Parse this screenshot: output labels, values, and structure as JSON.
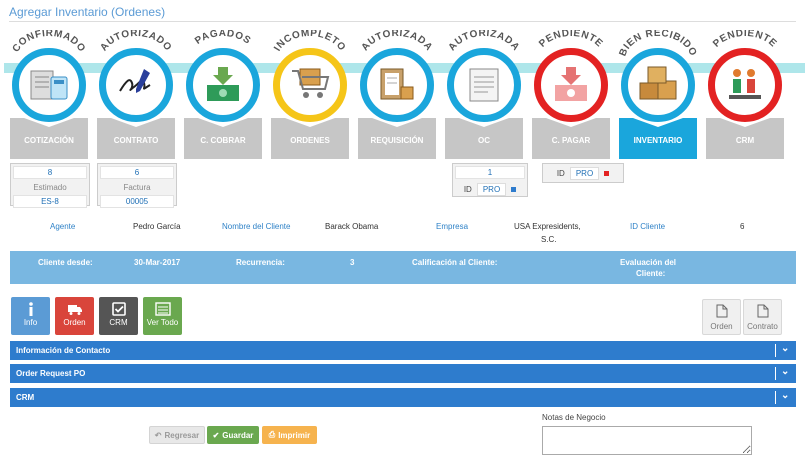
{
  "page": {
    "title": "Agregar Inventario (Ordenes)"
  },
  "steps": [
    {
      "arc": "CONFIRMADO",
      "name": "COTIZACIÓN",
      "ring": "#1aa6dc",
      "icon": "calculator-doc-icon",
      "active": false
    },
    {
      "arc": "AUTORIZADO",
      "name": "CONTRATO",
      "ring": "#1aa6dc",
      "icon": "signature-icon",
      "active": false
    },
    {
      "arc": "PAGADOS",
      "name": "C. COBRAR",
      "ring": "#1aa6dc",
      "icon": "money-in-icon",
      "active": false
    },
    {
      "arc": "INCOMPLETO",
      "name": "ORDENES",
      "ring": "#f5c518",
      "icon": "cart-icon",
      "active": false
    },
    {
      "arc": "AUTORIZADA",
      "name": "REQUISICIÓN",
      "ring": "#1aa6dc",
      "icon": "clipboard-boxes-icon",
      "active": false
    },
    {
      "arc": "AUTORIZADA",
      "name": "OC",
      "ring": "#1aa6dc",
      "icon": "document-icon",
      "active": false
    },
    {
      "arc": "PENDIENTE",
      "name": "C. PAGAR",
      "ring": "#e32222",
      "icon": "money-out-icon",
      "active": false
    },
    {
      "arc": "BIEN RECIBIDO",
      "name": "INVENTARIO",
      "ring": "#1aa6dc",
      "icon": "boxes-icon",
      "active": true
    },
    {
      "arc": "PENDIENTE",
      "name": "CRM",
      "ring": "#e32222",
      "icon": "people-chart-icon",
      "active": false
    }
  ],
  "cotizacion_box": {
    "number": "8",
    "label": "Estimado",
    "code": "ES-8"
  },
  "contrato_box": {
    "number": "6",
    "label": "Factura",
    "code": "00005"
  },
  "oc_box": {
    "number": "1",
    "id_label": "ID",
    "id_value": "PRO",
    "status_color": "#2e7ccd"
  },
  "cpagar_box": {
    "id_label": "ID",
    "id_value": "PRO",
    "status_color": "#e32222"
  },
  "meta": {
    "agent_label": "Agente",
    "agent_value": "Pedro García",
    "client_label": "Nombre del Cliente",
    "client_value": "Barack Obama",
    "company_label": "Empresa",
    "company_value_1": "USA Expresidents,",
    "company_value_2": "S.C.",
    "client_id_label": "ID Cliente",
    "client_id_value": "6"
  },
  "summary": {
    "since_label": "Cliente desde:",
    "since_value": "30-Mar-2017",
    "recurrence_label": "Recurrencia:",
    "recurrence_value": "3",
    "rating_label": "Calificación al Cliente:",
    "evaluation_label_1": "Evaluación del",
    "evaluation_label_2": "Cliente:"
  },
  "action_buttons": {
    "info": "Info",
    "orden": "Orden",
    "crm": "CRM",
    "ver_todo": "Ver Todo",
    "doc_orden": "Orden",
    "doc_contrato": "Contrato"
  },
  "accordions": [
    {
      "label": "Información de Contacto"
    },
    {
      "label": "Order Request PO"
    },
    {
      "label": "CRM"
    }
  ],
  "footer": {
    "regresar": "Regresar",
    "guardar": "Guardar",
    "imprimir": "Imprimir",
    "notes_label": "Notas de Negocio"
  },
  "colors": {
    "blue": "#2e7ccd",
    "light_blue": "#79b7e1",
    "accent": "#1aa6dc",
    "red": "#e32222",
    "green": "#6aa84f"
  }
}
